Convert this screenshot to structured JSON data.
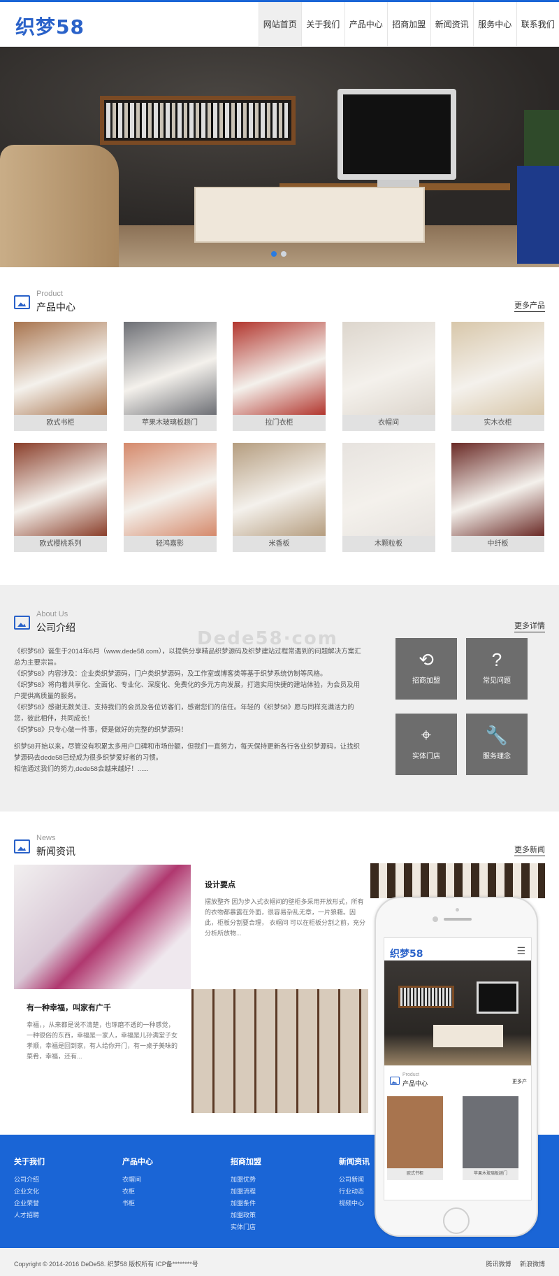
{
  "header": {
    "logo": "织梦58",
    "nav": [
      "网站首页",
      "关于我们",
      "产品中心",
      "招商加盟",
      "新闻资讯",
      "服务中心",
      "联系我们"
    ],
    "active_nav": 0
  },
  "banner": {
    "slides": 2,
    "active_slide": 0
  },
  "products": {
    "title_en": "Product",
    "title_cn": "产品中心",
    "more": "更多产品",
    "items": [
      {
        "name": "欧式书柜",
        "color": "#a8744e"
      },
      {
        "name": "苹果木玻璃板趟门",
        "color": "#6d6f75"
      },
      {
        "name": "拉门衣柜",
        "color": "#b2362e"
      },
      {
        "name": "衣帽间",
        "color": "#ddd6cd"
      },
      {
        "name": "实木衣柜",
        "color": "#d8c7aa"
      },
      {
        "name": "欧式樱桃系列",
        "color": "#8a3e2a"
      },
      {
        "name": "轻鸿嘉影",
        "color": "#d5896b"
      },
      {
        "name": "米香板",
        "color": "#b59d7f"
      },
      {
        "name": "木颗粒板",
        "color": "#e7e3df"
      },
      {
        "name": "中纤板",
        "color": "#6a2a26"
      }
    ]
  },
  "about": {
    "title_en": "About Us",
    "title_cn": "公司介绍",
    "more": "更多详情",
    "watermark": "Dede58·com",
    "paragraphs": [
      "《织梦58》诞生于2014年6月（www.dede58.com），以提供分享精品织梦源码及织梦建站过程常遇到的问题解决方案汇总为主要宗旨。",
      "《织梦58》内容涉及：企业类织梦源码，门户类织梦源码，及工作室或博客类等基于织梦系统仿制等风格。",
      "《织梦58》将向着共享化、全面化、专业化、深度化、免费化的多元方向发展，打造实用快捷的建站体验，为会员及用户提供高质量的服务。",
      "《织梦58》感谢无数关注、支持我们的会员及各位访客们，感谢您们的信任。年轻的《织梦58》愿与同样充满活力的您，彼此相伴，共同成长！",
      "《织梦58》只专心做一件事，便是做好的完整的织梦源码！",
      "",
      "织梦58开始以来，尽管没有积累太多用户口碑和市场份额，但我们一直努力，每天保持更新各行各业织梦源码，让找织梦源码去dede58已经成为很多织梦爱好者的习惯。",
      "相信通过我们的努力,dede58会越来越好！......"
    ],
    "tiles": [
      {
        "label": "招商加盟",
        "icon": "refresh-icon",
        "glyph": "⟲"
      },
      {
        "label": "常见问题",
        "icon": "question-icon",
        "glyph": "?"
      },
      {
        "label": "实体门店",
        "icon": "location-pin-icon",
        "glyph": "⌖"
      },
      {
        "label": "服务理念",
        "icon": "wrench-icon",
        "glyph": "🔧"
      }
    ]
  },
  "news": {
    "title_en": "News",
    "title_cn": "新闻资讯",
    "more": "更多新闻",
    "items": [
      {
        "title": "设计要点",
        "desc": "摆放整齐 因为步入式衣帽间的壁柜多采用开放形式，所有的衣物都暴露在外面，很容易杂乱无章，一片狼藉。因此，柜板分割要合理， 衣帽间 可以在柜板分割之前，充分分析所放物..."
      },
      {
        "title": "有一种幸福，叫家有广千",
        "desc": "幸福，，从来都是说不清楚，也琢磨不透的一种感觉，一种很俗的东西，幸福是一家人，幸福是儿孙满堂子女孝顺，幸福是回到家，有人给你开门，有一桌子美味的菜肴，幸福，还有..."
      }
    ]
  },
  "phone": {
    "logo": "织梦58",
    "menu": "☰",
    "section_en": "Product",
    "section_cn": "产品中心",
    "more": "更多产",
    "cards": [
      "欧式书柜",
      "苹果木玻璃板趟门"
    ]
  },
  "footer": {
    "columns": [
      {
        "title": "关于我们",
        "links": [
          "公司介绍",
          "企业文化",
          "企业荣誉",
          "人才招聘"
        ]
      },
      {
        "title": "产品中心",
        "links": [
          "衣帽间",
          "衣柜",
          "书柜"
        ]
      },
      {
        "title": "招商加盟",
        "links": [
          "加盟优势",
          "加盟流程",
          "加盟条件",
          "加盟政策",
          "实体门店"
        ]
      },
      {
        "title": "新闻资讯",
        "links": [
          "公司新闻",
          "行业动态",
          "视频中心"
        ]
      }
    ],
    "copyright": "Copyright © 2014-2016 DeDe58. 织梦58 版权所有 ICP备********号",
    "social": [
      "腾讯微博",
      "新浪微博"
    ]
  },
  "colors": {
    "brand": "#1a65d6",
    "logo": "#2a62c9",
    "tile": "#6d6d6d"
  }
}
